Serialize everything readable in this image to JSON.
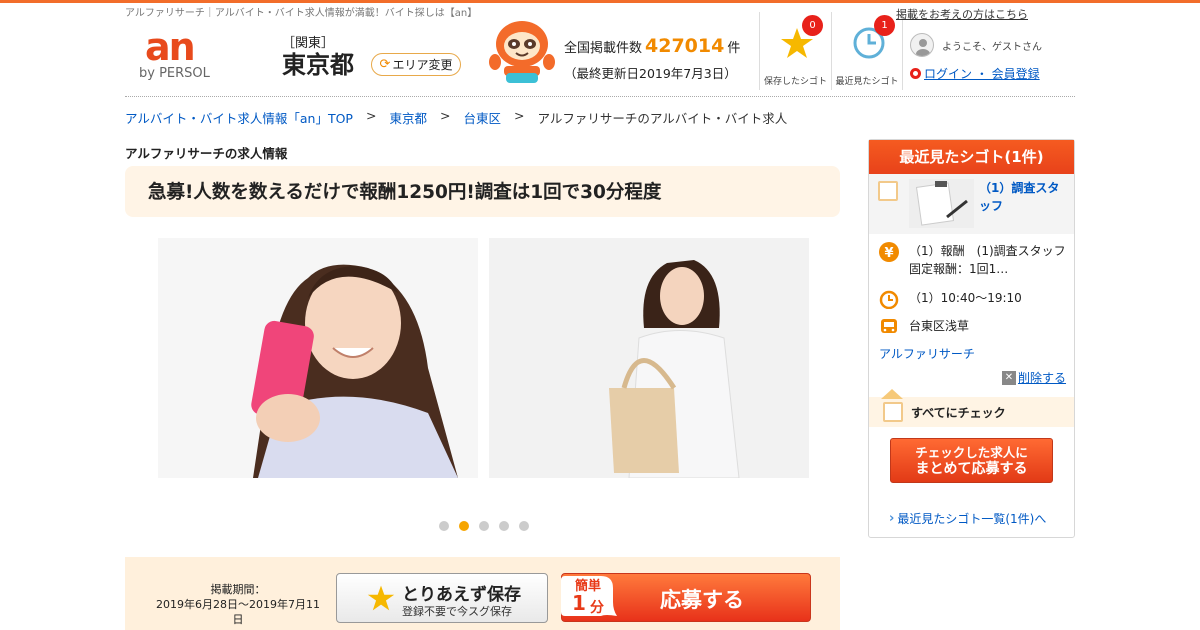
{
  "header": {
    "tagline": "アルファリサーチ｜アルバイト・バイト求人情報が満載！バイト探しは【an】",
    "logo_text": "an",
    "logo_sub": "by PERSOL",
    "area_region": "［関東］",
    "area_pref": "東京都",
    "area_change_label": "エリア変更",
    "count_prefix": "全国掲載件数",
    "count_value": "427014",
    "count_suffix": "件",
    "update_text": "（最終更新日2019年7月3日）",
    "saved_label": "保存したシゴト",
    "saved_count": "0",
    "recent_label": "最近見たシゴト",
    "recent_count": "1",
    "publish_link": "掲載をお考えの方はこちら",
    "guest_text": "ようこそ、ゲストさん",
    "login_link": "ログイン ・ 会員登録"
  },
  "breadcrumb": [
    "アルバイト・バイト求人情報「an」TOP",
    "東京都",
    "台東区",
    "アルファリサーチのアルバイト・バイト求人"
  ],
  "breadcrumb_sep": ">",
  "main": {
    "company_title": "アルファリサーチの求人情報",
    "job_title": "急募!人数を数えるだけで報酬1250円!調査は1回で30分程度",
    "slide_count": 5,
    "active_slide": 2
  },
  "apply_bar": {
    "period_label": "掲載期間：",
    "period_value": "2019年6月28日～2019年7月11日",
    "save_main": "とりあえず保存",
    "save_sub": "登録不要で今スグ保存",
    "quick_top": "簡単",
    "quick_num": "1",
    "quick_unit": "分",
    "apply_label": "応募する"
  },
  "sidebar": {
    "title": "最近見たシゴト(1件)",
    "job_link": "（1）調査スタッフ",
    "pay_text": "（1）報酬　(1)調査スタッフ固定報酬：1回1…",
    "time_text": "（1）10:40～19:10",
    "station_text": "台東区浅草",
    "company": "アルファリサーチ",
    "delete_label": "削除する",
    "check_all": "すべてにチェック",
    "bulk_apply_line1": "チェックした求人に",
    "bulk_apply_line2": "まとめて応募する",
    "recent_list_link": "最近見たシゴト一覧(1件)へ"
  },
  "colors": {
    "accent": "#f26d2a",
    "count_orange": "#f18a00",
    "link_blue": "#0059c4",
    "badge_red": "#e8211a"
  }
}
